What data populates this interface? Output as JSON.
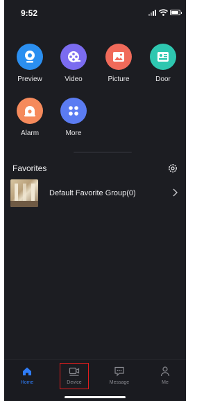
{
  "status_bar": {
    "time": "9:52"
  },
  "apps": [
    {
      "label": "Preview",
      "icon": "camera-icon",
      "color": "#2b8ff0"
    },
    {
      "label": "Video",
      "icon": "film-reel-icon",
      "color": "#7b6cf0"
    },
    {
      "label": "Picture",
      "icon": "image-icon",
      "color": "#f06a5a"
    },
    {
      "label": "Door",
      "icon": "door-panel-icon",
      "color": "#2ec7b0"
    },
    {
      "label": "Alarm",
      "icon": "alarm-icon",
      "color": "#f58a5c"
    },
    {
      "label": "More",
      "icon": "grid-dots-icon",
      "color": "#5b7cf2"
    }
  ],
  "favorites": {
    "title": "Favorites",
    "group_label": "Default Favorite Group(0)"
  },
  "tabs": [
    {
      "label": "Home",
      "icon": "home-icon",
      "active": true
    },
    {
      "label": "Device",
      "icon": "device-camera-icon",
      "active": false,
      "highlighted": true
    },
    {
      "label": "Message",
      "icon": "message-icon",
      "active": false
    },
    {
      "label": "Me",
      "icon": "person-icon",
      "active": false
    }
  ],
  "colors": {
    "background": "#1c1d22",
    "accent": "#2f7cf6",
    "highlight_box": "#e21d1d"
  }
}
